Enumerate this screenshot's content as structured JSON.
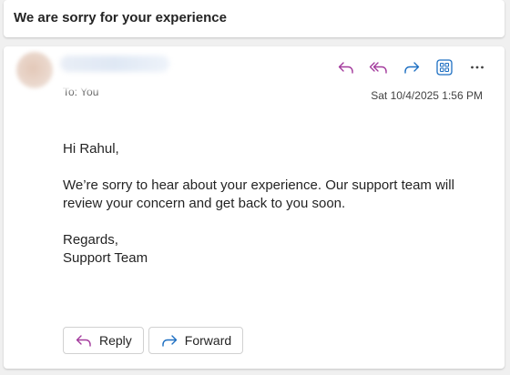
{
  "subject": "We are sorry for your experience",
  "message": {
    "sender_name": "",
    "to_line": "To:  You",
    "date": "Sat 10/4/2025 1:56 PM",
    "toolbar": {
      "reply_icon": "reply-icon",
      "reply_all_icon": "reply-all-icon",
      "forward_icon": "forward-icon",
      "apps_icon": "apps-icon",
      "more_icon": "more-icon"
    },
    "body": {
      "greeting": "Hi Rahul,",
      "paragraph": "We’re sorry to hear about your experience. Our support team will review your concern and get back to you soon.",
      "closing": "Regards,",
      "signature": "Support Team"
    }
  },
  "actions": {
    "reply_label": "Reply",
    "forward_label": "Forward"
  },
  "colors": {
    "reply_purple": "#a33a9c",
    "forward_blue": "#1d6fc2",
    "apps_blue": "#1d6fc2"
  }
}
